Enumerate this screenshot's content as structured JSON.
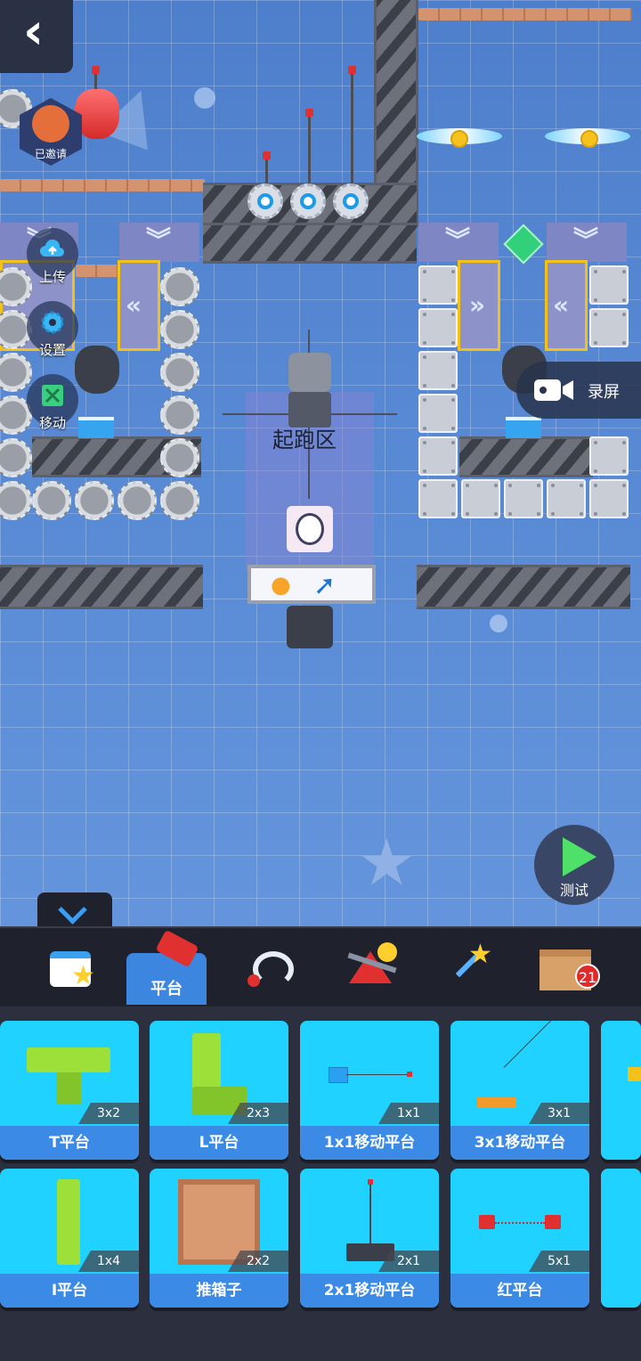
{
  "nav": {
    "back_label": "‹"
  },
  "side_buttons": {
    "upload": "上传",
    "settings": "设置",
    "move": "移动"
  },
  "badge": {
    "invited": "已邀请"
  },
  "scene": {
    "start_zone_label": "起跑区"
  },
  "record": {
    "label": "录屏"
  },
  "test": {
    "label": "测试"
  },
  "tabs": [
    {
      "name": "calendar",
      "label": ""
    },
    {
      "name": "platform",
      "label": "平台"
    },
    {
      "name": "trap",
      "label": ""
    },
    {
      "name": "seesaw",
      "label": ""
    },
    {
      "name": "wand",
      "label": ""
    },
    {
      "name": "box",
      "label": "",
      "badge": "21"
    }
  ],
  "items_row1": [
    {
      "name": "T平台",
      "size": "3x2"
    },
    {
      "name": "L平台",
      "size": "2x3"
    },
    {
      "name": "1x1移动平台",
      "size": "1x1"
    },
    {
      "name": "3x1移动平台",
      "size": "3x1"
    }
  ],
  "items_row2": [
    {
      "name": "I平台",
      "size": "1x4"
    },
    {
      "name": "推箱子",
      "size": "2x2"
    },
    {
      "name": "2x1移动平台",
      "size": "2x1"
    },
    {
      "name": "红平台",
      "size": "5x1"
    }
  ],
  "colors": {
    "accent": "#3c86e0",
    "card": "#1fd2ff",
    "conveyor_border": "#f2c21b"
  }
}
